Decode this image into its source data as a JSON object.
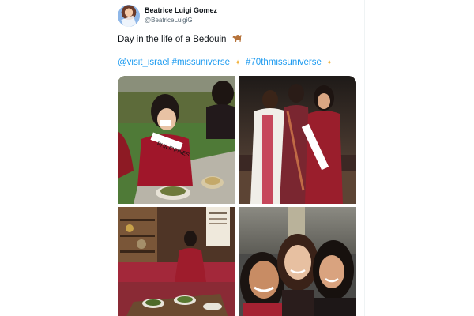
{
  "tweet": {
    "author_name": "Beatrice Luigi Gomez",
    "author_handle": "@BeatriceLuigiG",
    "text": "Day in the life of a Bedouin",
    "emoji_icon": "camel-icon",
    "hashtags": [
      "@visit_israel",
      "#missuniverse",
      "#70thmissuniverse"
    ],
    "sparkle_icon": "sparkle-icon"
  },
  "media": {
    "count": 4,
    "photos": [
      {
        "alt": "photo-top-left",
        "description": "women in red embroidered dresses rolling grape leaves at a table",
        "sash_text": "PHILIPPINES"
      },
      {
        "alt": "photo-top-right",
        "description": "three women standing in a tent, one wearing a sash"
      },
      {
        "alt": "photo-bottom-left",
        "description": "woman seated in a Bedouin tent with dishes on a low table"
      },
      {
        "alt": "photo-bottom-right",
        "description": "selfie of three women smiling"
      }
    ]
  },
  "colors": {
    "link": "#1d9bf0",
    "text": "#0f1419",
    "muted": "#536471",
    "sparkle": "#f2b23b"
  }
}
